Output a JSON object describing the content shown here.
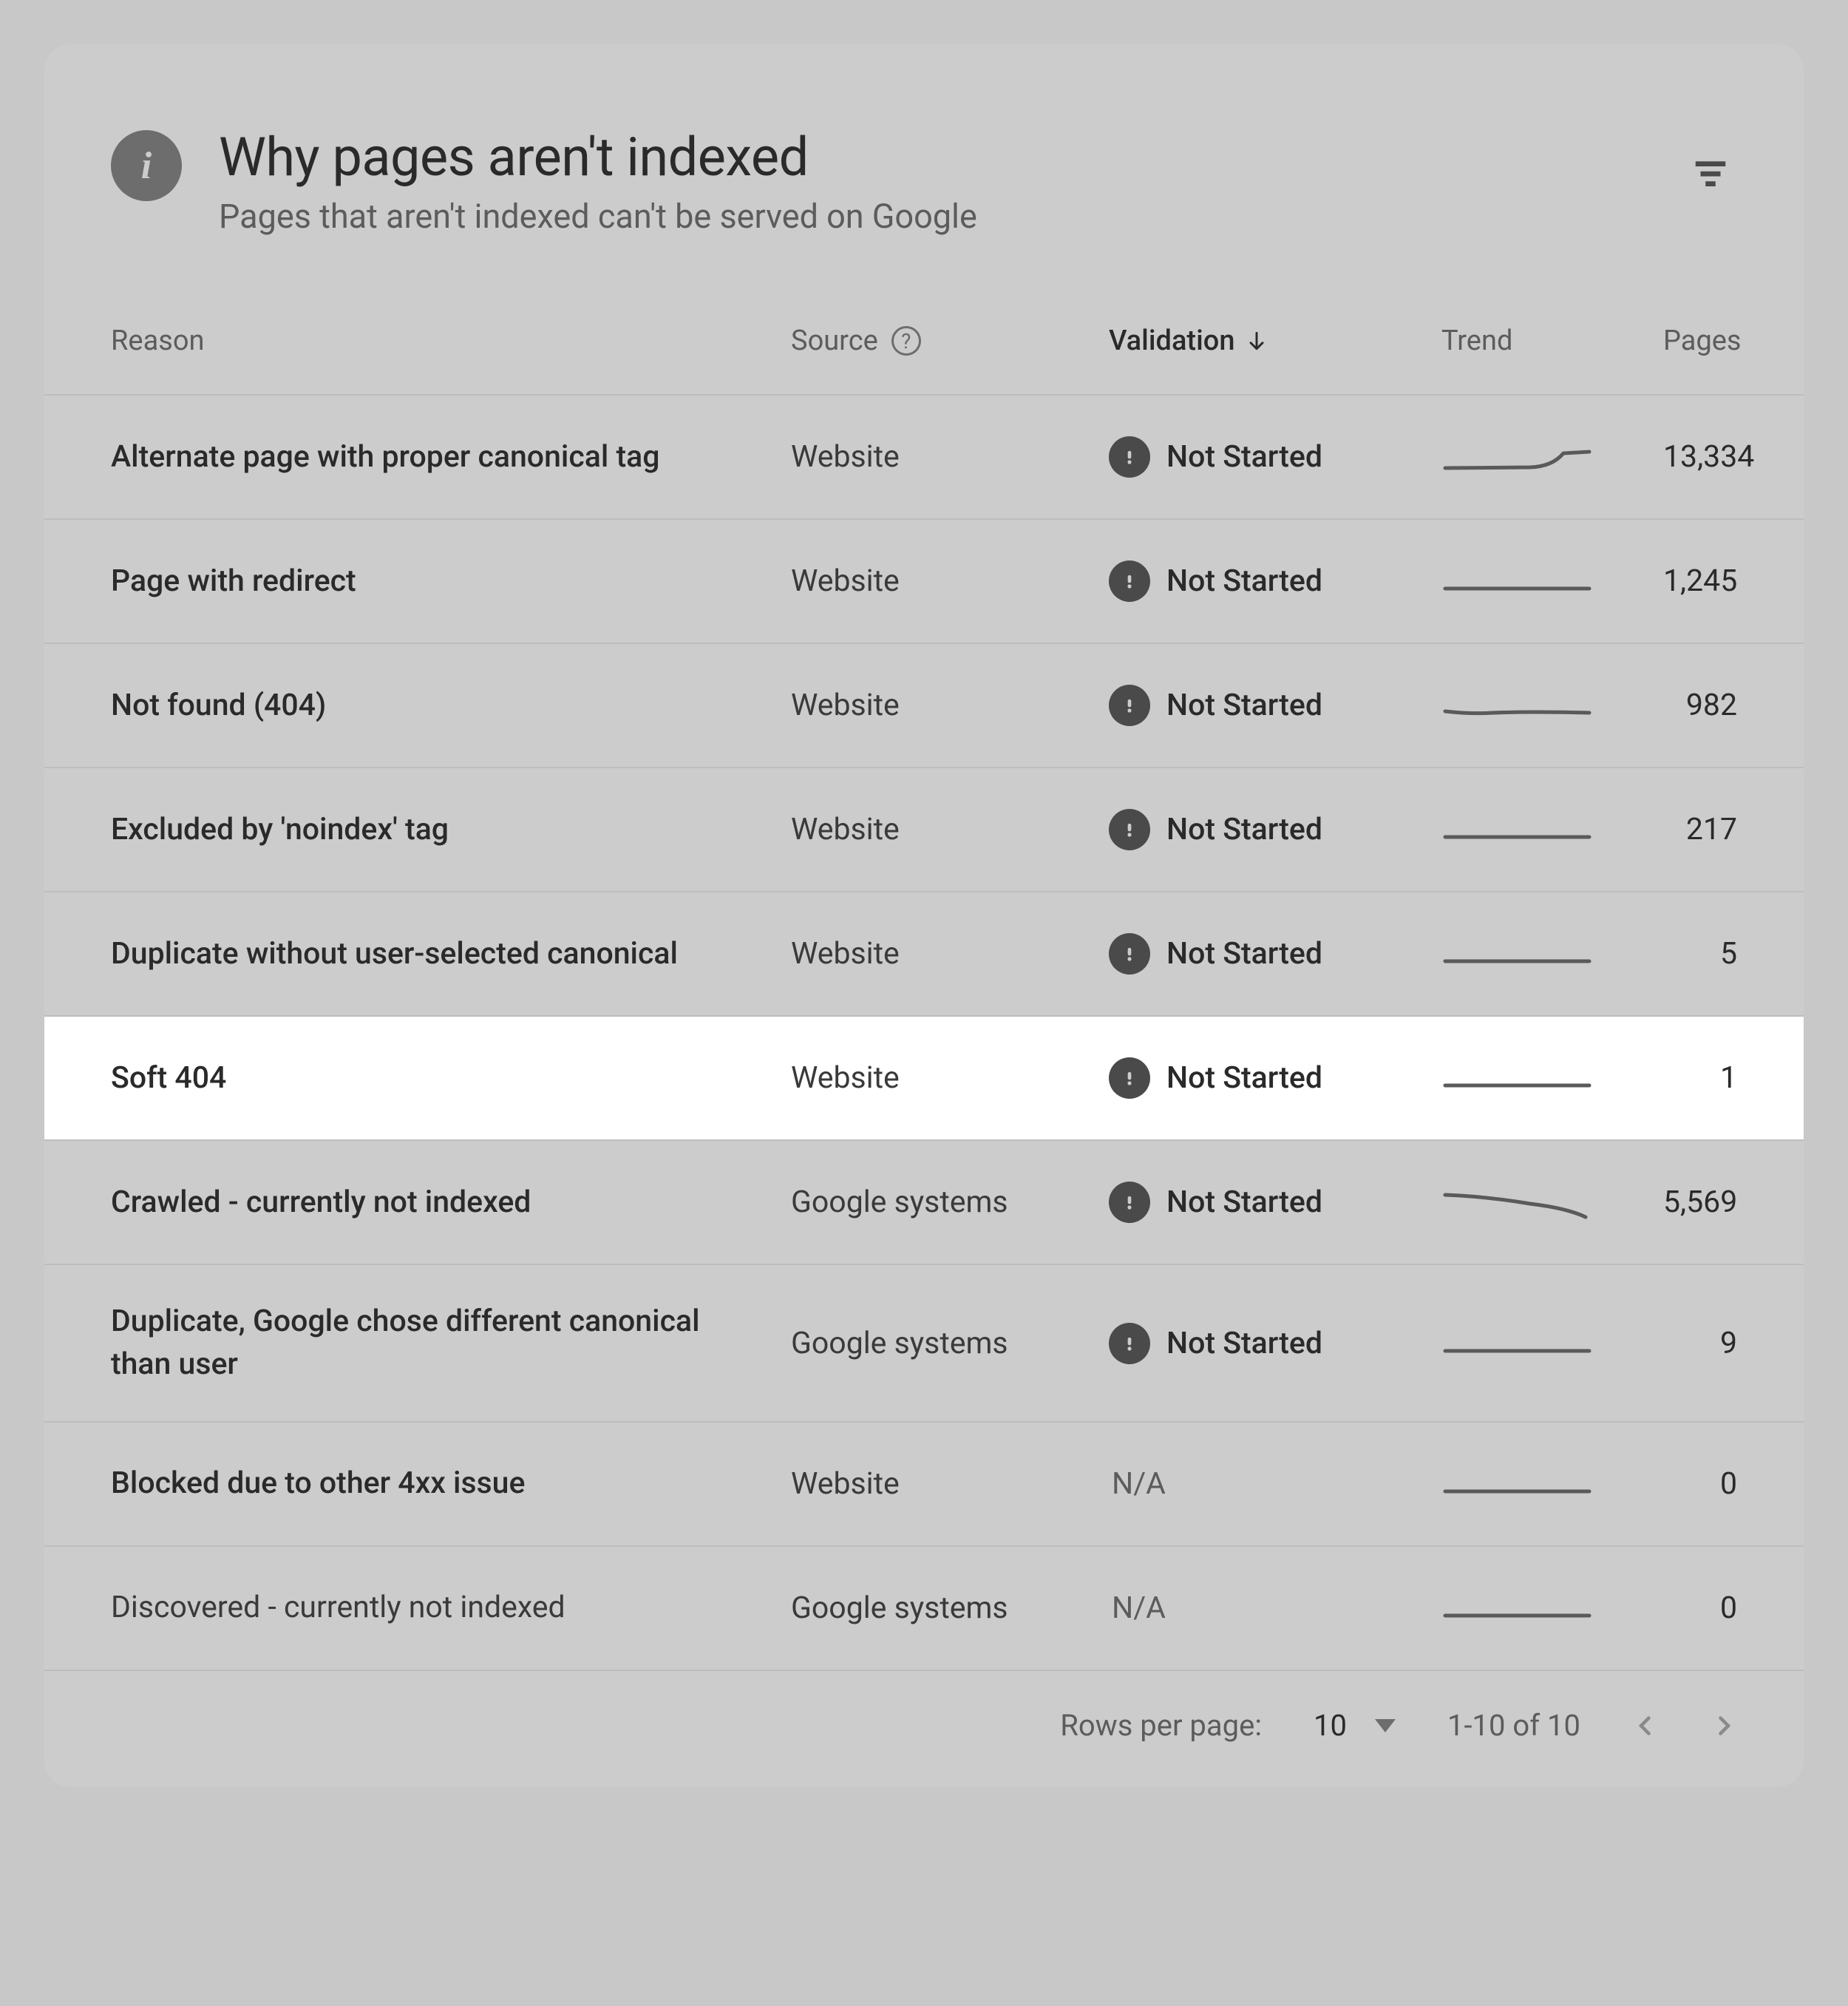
{
  "header": {
    "title": "Why pages aren't indexed",
    "subtitle": "Pages that aren't indexed can't be served on Google"
  },
  "columns": {
    "reason": "Reason",
    "source": "Source",
    "validation": "Validation",
    "trend": "Trend",
    "pages": "Pages"
  },
  "rows": [
    {
      "reason": "Alternate page with proper canonical tag",
      "source": "Website",
      "validation": "Not Started",
      "pages": "13,334",
      "trend": "rise",
      "highlight": false
    },
    {
      "reason": "Page with redirect",
      "source": "Website",
      "validation": "Not Started",
      "pages": "1,245",
      "trend": "flat",
      "highlight": false
    },
    {
      "reason": "Not found (404)",
      "source": "Website",
      "validation": "Not Started",
      "pages": "982",
      "trend": "wave",
      "highlight": false
    },
    {
      "reason": "Excluded by 'noindex' tag",
      "source": "Website",
      "validation": "Not Started",
      "pages": "217",
      "trend": "flat",
      "highlight": false
    },
    {
      "reason": "Duplicate without user-selected canonical",
      "source": "Website",
      "validation": "Not Started",
      "pages": "5",
      "trend": "flat",
      "highlight": false
    },
    {
      "reason": "Soft 404",
      "source": "Website",
      "validation": "Not Started",
      "pages": "1",
      "trend": "flat",
      "highlight": true
    },
    {
      "reason": "Crawled - currently not indexed",
      "source": "Google systems",
      "validation": "Not Started",
      "pages": "5,569",
      "trend": "fall",
      "highlight": false
    },
    {
      "reason": "Duplicate, Google chose different canonical than user",
      "source": "Google systems",
      "validation": "Not Started",
      "pages": "9",
      "trend": "flat",
      "highlight": false
    },
    {
      "reason": "Blocked due to other 4xx issue",
      "source": "Website",
      "validation": "N/A",
      "pages": "0",
      "trend": "flat",
      "highlight": false
    },
    {
      "reason": "Discovered - currently not indexed",
      "source": "Google systems",
      "validation": "N/A",
      "pages": "0",
      "trend": "flat",
      "highlight": false
    }
  ],
  "footer": {
    "rows_label": "Rows per page:",
    "rows_value": "10",
    "range": "1-10 of 10"
  }
}
